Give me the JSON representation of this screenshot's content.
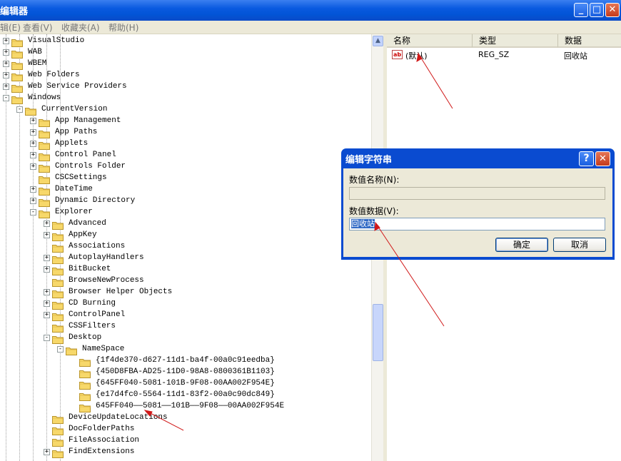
{
  "window": {
    "title": "编辑器",
    "caption_buttons": {
      "minimize": "_",
      "maximize": "□",
      "close": "✕"
    }
  },
  "menubar": {
    "items": [
      "辑(E)",
      "查看(V)",
      "收藏夹(A)",
      "帮助(H)"
    ]
  },
  "tree": {
    "rows": [
      {
        "label": "VisualStudio",
        "depth": 0,
        "expander": "+"
      },
      {
        "label": "WAB",
        "depth": 0,
        "expander": "+"
      },
      {
        "label": "WBEM",
        "depth": 0,
        "expander": "+"
      },
      {
        "label": "Web Folders",
        "depth": 0,
        "expander": "+"
      },
      {
        "label": "Web Service Providers",
        "depth": 0,
        "expander": "+"
      },
      {
        "label": "Windows",
        "depth": 0,
        "expander": "-"
      },
      {
        "label": "CurrentVersion",
        "depth": 1,
        "expander": "-"
      },
      {
        "label": "App Management",
        "depth": 2,
        "expander": "+"
      },
      {
        "label": "App Paths",
        "depth": 2,
        "expander": "+"
      },
      {
        "label": "Applets",
        "depth": 2,
        "expander": "+"
      },
      {
        "label": "Control Panel",
        "depth": 2,
        "expander": "+"
      },
      {
        "label": "Controls Folder",
        "depth": 2,
        "expander": "+"
      },
      {
        "label": "CSCSettings",
        "depth": 2,
        "expander": ""
      },
      {
        "label": "DateTime",
        "depth": 2,
        "expander": "+"
      },
      {
        "label": "Dynamic Directory",
        "depth": 2,
        "expander": "+"
      },
      {
        "label": "Explorer",
        "depth": 2,
        "expander": "-"
      },
      {
        "label": "Advanced",
        "depth": 3,
        "expander": "+"
      },
      {
        "label": "AppKey",
        "depth": 3,
        "expander": "+"
      },
      {
        "label": "Associations",
        "depth": 3,
        "expander": ""
      },
      {
        "label": "AutoplayHandlers",
        "depth": 3,
        "expander": "+"
      },
      {
        "label": "BitBucket",
        "depth": 3,
        "expander": "+"
      },
      {
        "label": "BrowseNewProcess",
        "depth": 3,
        "expander": ""
      },
      {
        "label": "Browser Helper Objects",
        "depth": 3,
        "expander": "+"
      },
      {
        "label": "CD Burning",
        "depth": 3,
        "expander": "+"
      },
      {
        "label": "ControlPanel",
        "depth": 3,
        "expander": "+"
      },
      {
        "label": "CSSFilters",
        "depth": 3,
        "expander": ""
      },
      {
        "label": "Desktop",
        "depth": 3,
        "expander": "-"
      },
      {
        "label": "NameSpace",
        "depth": 4,
        "expander": "-"
      },
      {
        "label": "{1f4de370-d627-11d1-ba4f-00a0c91eedba}",
        "depth": 5,
        "expander": ""
      },
      {
        "label": "{450D8FBA-AD25-11D0-98A8-0800361B1103}",
        "depth": 5,
        "expander": ""
      },
      {
        "label": "{645FF040-5081-101B-9F08-00AA002F954E}",
        "depth": 5,
        "expander": ""
      },
      {
        "label": "{e17d4fc0-5564-11d1-83f2-00a0c90dc849}",
        "depth": 5,
        "expander": ""
      },
      {
        "label": "645FF040——5081——101B——9F08——00AA002F954E",
        "depth": 5,
        "expander": ""
      },
      {
        "label": "DeviceUpdateLocations",
        "depth": 3,
        "expander": ""
      },
      {
        "label": "DocFolderPaths",
        "depth": 3,
        "expander": ""
      },
      {
        "label": "FileAssociation",
        "depth": 3,
        "expander": ""
      },
      {
        "label": "FindExtensions",
        "depth": 3,
        "expander": "+"
      }
    ]
  },
  "list": {
    "columns": [
      "名称",
      "类型",
      "数据"
    ],
    "rows": [
      {
        "name": "(默认)",
        "type": "REG_SZ",
        "data": "回收站",
        "icon": "ab"
      }
    ]
  },
  "dialog": {
    "title": "编辑字符串",
    "help_glyph": "?",
    "close_glyph": "✕",
    "value_name_label": "数值名称(N):",
    "value_name": "",
    "value_data_label": "数值数据(V):",
    "value_data": "回收站",
    "ok": "确定",
    "cancel": "取消"
  },
  "colors": {
    "titlebar": "#0a5ae0",
    "selection": "#316ac5",
    "annotation_arrow": "#d01818"
  }
}
